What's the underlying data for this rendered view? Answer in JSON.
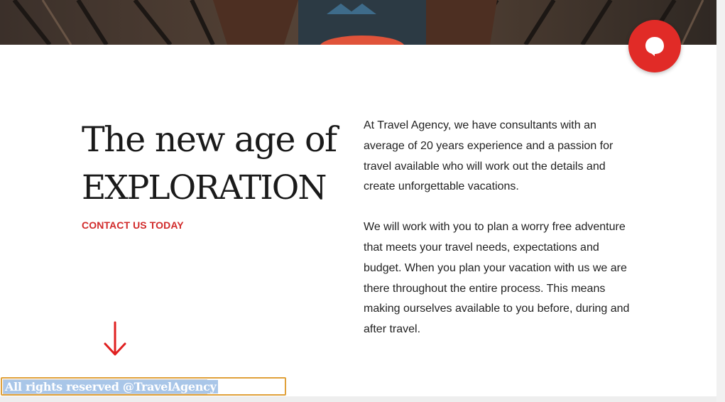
{
  "hero": {
    "image_icon": "wooden-rowboats-photo"
  },
  "chat_widget": {
    "icon": "chat-bubble-icon",
    "color": "#e12b27"
  },
  "intro": {
    "headline_line1": "The new age of",
    "headline_line2": "EXPLORATION",
    "cta_label": "CONTACT US TODAY",
    "cta_color": "#d12a2a",
    "paragraph1": "At Travel Agency, we have consultants with an average of 20 years experience and a passion for travel available who will work out the details and create unforgettable vacations.",
    "paragraph2": "We will work with you to plan a worry free adventure that meets your travel needs, expectations and budget. When you plan your vacation with us we are there throughout the entire process. This means making ourselves available to you before, during and after travel."
  },
  "annotation": {
    "icon": "arrow-down-icon",
    "color": "#e02020"
  },
  "footer": {
    "text": "All rights reserved @TravelAgency",
    "highlight_color": "#e0a13a"
  }
}
